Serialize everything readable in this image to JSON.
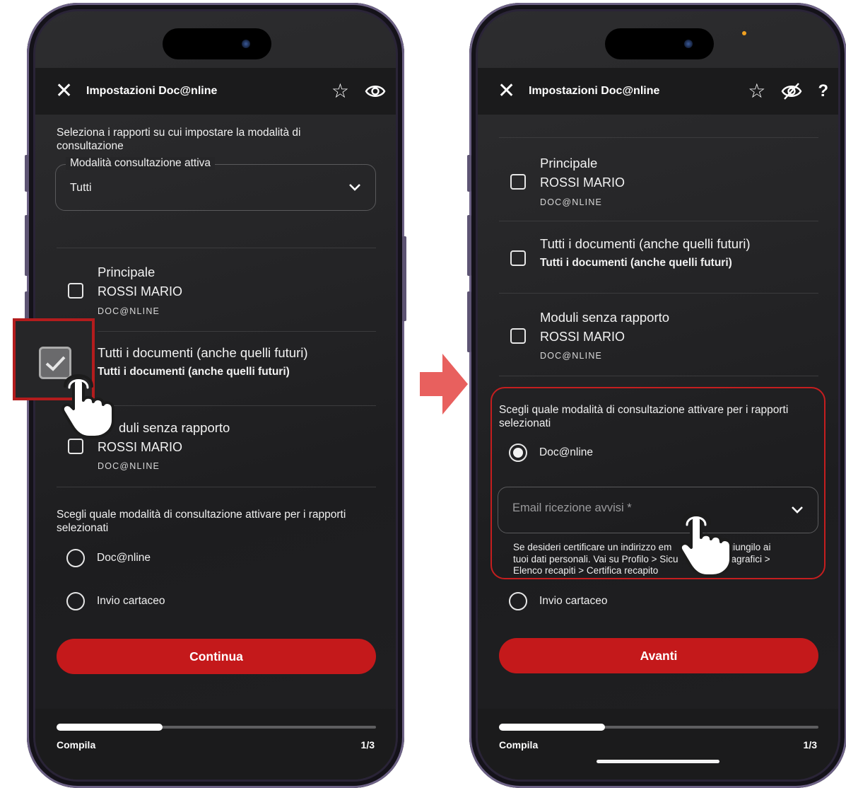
{
  "left_screen": {
    "header": {
      "title": "Impostazioni Doc@nline",
      "close_icon": "close-icon",
      "icons": [
        "star-icon",
        "eye-icon"
      ]
    },
    "intro": "Seleziona i rapporti su cui impostare la modalità di consultazione",
    "select": {
      "legend": "Modalità consultazione attiva",
      "value": "Tutti"
    },
    "items": [
      {
        "line1": "Principale",
        "line2": "ROSSI MARIO",
        "line3": "DOC@NLINE",
        "checked": false
      },
      {
        "line1": "Tutti i documenti (anche quelli futuri)",
        "line2": "Tutti i documenti (anche quelli futuri)",
        "checked": true
      },
      {
        "line1": "Moduli senza rapporto",
        "line1_visible": "duli senza rapporto",
        "line2": "ROSSI MARIO",
        "line3": "DOC@NLINE",
        "checked": false
      }
    ],
    "question": "Scegli quale modalità di consultazione attivare per i rapporti selezionati",
    "options": [
      {
        "label": "Doc@nline",
        "selected": false
      },
      {
        "label": "Invio cartaceo",
        "selected": false
      }
    ],
    "cta": "Continua",
    "footer": {
      "step_label": "Compila",
      "step_count": "1/3",
      "progress": 0.33
    }
  },
  "right_screen": {
    "header": {
      "title": "Impostazioni Doc@nline",
      "close_icon": "close-icon",
      "icons": [
        "star-icon",
        "eye-off-icon",
        "help-icon"
      ],
      "help": "?"
    },
    "items": [
      {
        "line1": "Principale",
        "line2": "ROSSI MARIO",
        "line3": "DOC@NLINE",
        "checked": false
      },
      {
        "line1": "Tutti i documenti (anche quelli futuri)",
        "line2": "Tutti i documenti (anche quelli futuri)",
        "checked": false
      },
      {
        "line1": "Moduli senza rapporto",
        "line2": "ROSSI MARIO",
        "line3": "DOC@NLINE",
        "checked": false
      }
    ],
    "question": "Scegli quale modalità di consultazione attivare per i rapporti selezionati",
    "options": [
      {
        "label": "Doc@nline",
        "selected": true
      },
      {
        "label": "Invio cartaceo",
        "selected": false
      }
    ],
    "email_select": {
      "placeholder": "Email ricezione avvisi *"
    },
    "hint": "Se desideri certificare un indirizzo email differente, aggiungilo ai tuoi dati personali. Vai su Profilo > Sicurezza e dati anagrafici > Elenco recapiti > Certifica recapito",
    "hint_line1_a": "Se desideri certificare un indirizzo em",
    "hint_line1_b": "nte, aggiungilo ai",
    "hint_line2_a": "tuoi dati personali. Vai su Profilo > Sicu",
    "hint_line2_b": "ati anagrafici >",
    "hint_line3": "Elenco recapiti > Certifica recapito",
    "cta": "Avanti",
    "footer": {
      "step_label": "Compila",
      "step_count": "1/3",
      "progress": 0.33
    }
  },
  "colors": {
    "accent": "#c4191b",
    "background": "#232325",
    "highlight": "#c51e1f",
    "arrow": "#e8605e"
  }
}
